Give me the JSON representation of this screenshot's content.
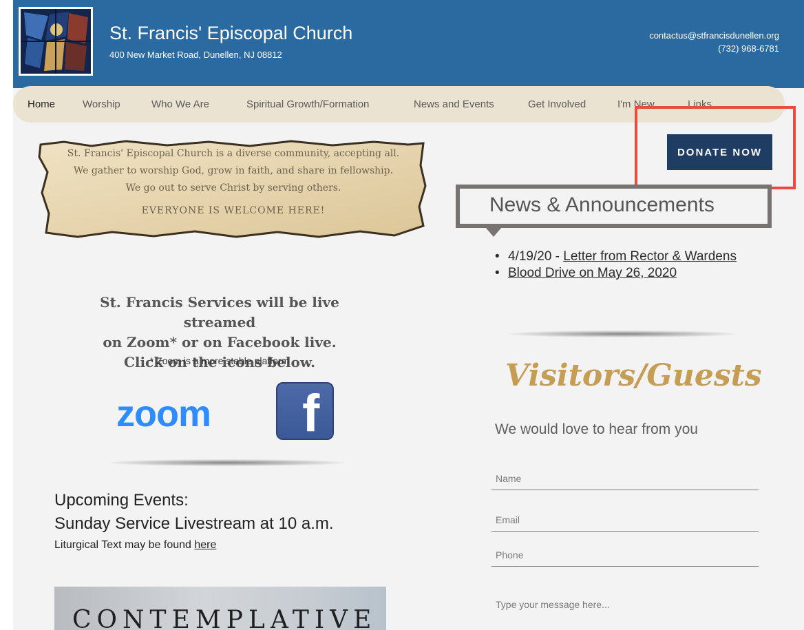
{
  "header": {
    "title": "St. Francis' Episcopal Church",
    "address": "400 New Market Road, Dunellen, NJ 08812",
    "email": "contactus@stfrancisdunellen.org",
    "phone": "(732) 968-6781"
  },
  "nav": {
    "items": [
      {
        "label": "Home",
        "active": true
      },
      {
        "label": "Worship"
      },
      {
        "label": "Who We Are"
      },
      {
        "label": "Spiritual Growth/Formation"
      },
      {
        "label": "News and Events"
      },
      {
        "label": "Get Involved"
      },
      {
        "label": "I'm New"
      },
      {
        "label": "Links"
      }
    ]
  },
  "donate": {
    "label": "DONATE NOW"
  },
  "mission": {
    "line1": "St. Francis' Episcopal Church is a diverse community, accepting all.",
    "line2": "We gather to worship God, grow in faith, and share in fellowship.",
    "line3": "We go out to serve Christ by serving others.",
    "line4": "EVERYONE IS WELCOME HERE!"
  },
  "news": {
    "title": "News & Announcements",
    "items": [
      {
        "prefix": "4/19/20 - ",
        "link": "Letter from Rector & Wardens"
      },
      {
        "prefix": "",
        "link": "Blood Drive on May 26, 2020"
      }
    ]
  },
  "services": {
    "line1": "St. Francis Services will be live streamed",
    "line2": "on Zoom* or on Facebook live.",
    "line3": "Click on the icons below.",
    "note": "* Zoom is a more stable platform",
    "zoom_label": "zoom",
    "facebook_label": "f"
  },
  "events": {
    "title": "Upcoming Events:",
    "subtitle": "Sunday Service Livestream at 10 a.m.",
    "liturgical_prefix": "Liturgical Text may be found ",
    "liturgical_link": "here",
    "image_text": "CONTEMPLATIVE"
  },
  "visitors": {
    "title": "Visitors/Guests",
    "subtitle": "We would love to hear from you",
    "name_placeholder": "Name",
    "email_placeholder": "Email",
    "phone_placeholder": "Phone",
    "message_placeholder": "Type your message here..."
  },
  "colors": {
    "header_blue": "#2b6aa1",
    "donate_navy": "#1f3d63",
    "highlight_red": "#e74c3c",
    "visitors_gold": "#c59d54"
  }
}
